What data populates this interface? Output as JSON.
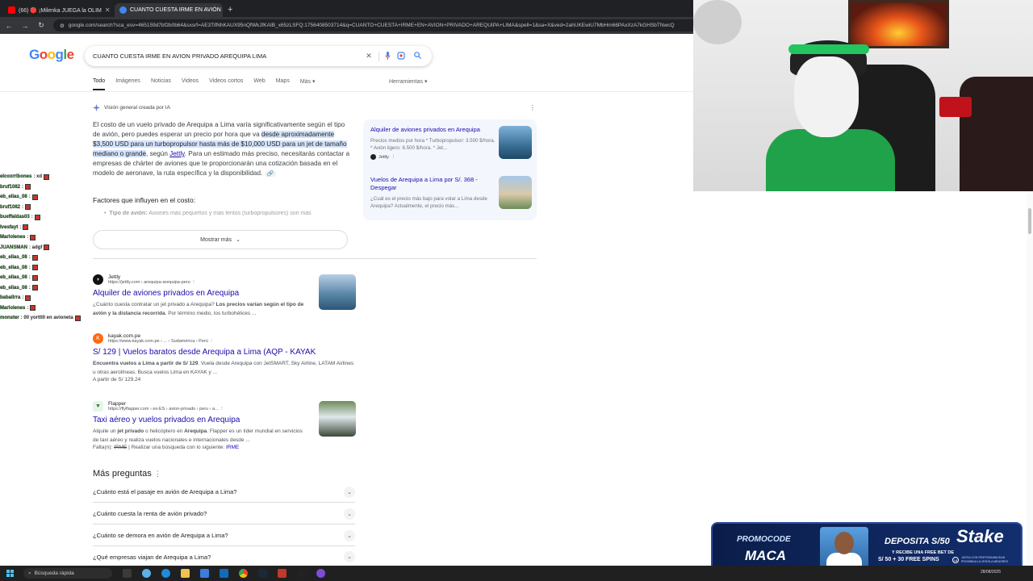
{
  "browser": {
    "tabs": [
      {
        "label": "(66) 🔴 ¡Milenka JUEGA la OLIM",
        "active": false
      },
      {
        "label": "CUANTO CUESTA IRME EN AVIÓN",
        "active": true
      }
    ],
    "url": "google.com/search?sca_esv=465159d7bf2b0b64&sxsrf=AE3TifNhKAUX95nQfWkJfKAIB_x65zLSFQ:1756408503714&q=CUANTO+CUESTA+IRME+EN+AVION+PRIVADO+AREQUIPA+LIMA&spell=1&sa=X&ved=2ahUKEwiU7MbHm66PAxXzA7kGHSbTNwcQ"
  },
  "google": {
    "logo": [
      "G",
      "o",
      "o",
      "g",
      "l",
      "e"
    ],
    "query": "CUANTO CUESTA IRME EN AVION PRIVADO AREQUIPA LIMA",
    "tabs": [
      "Todo",
      "Imágenes",
      "Noticias",
      "Videos",
      "Videos cortos",
      "Web",
      "Maps",
      "Más"
    ],
    "tools": "Herramientas"
  },
  "ai_overview": {
    "header": "Visión general creada por IA",
    "p1": "El costo de un vuelo privado de Arequipa a Lima varía significativamente según el tipo de avión, pero puedes esperar un precio por hora que va ",
    "highlight": "desde aproximadamente $3,500 USD para un turbopropulsor hasta más de $10,000 USD para un jet de tamaño mediano o grande",
    "p2": ", según ",
    "link": "Jettly",
    "p3": ". Para un estimado más preciso, necesitarás contactar a empresas de chárter de aviones que te proporcionarán una cotización basada en el modelo de aeronave, la ruta específica y la disponibilidad.",
    "factors_title": "Factores que influyen en el costo:",
    "factor1_label": "Tipo de avión:",
    "factor1_text": " Aviones más pequeños y más lentos (turbopropulsores) son más",
    "show_more": "Mostrar más",
    "cards": [
      {
        "title": "Alquiler de aviones privados en Arequipa",
        "desc": "Precios medios por hora * Turbopropulsor: 3.500 $/hora. * Avión ligero: 6.500 $/hora. * Jet...",
        "source": "Jettly"
      },
      {
        "title": "Vuelos de Arequipa a Lima por S/. 368 - Despegar",
        "desc": "¿Cuál es el precio más bajo para volar a Lima desde Arequipa? Actualmente, el precio más..."
      }
    ]
  },
  "results": [
    {
      "site": "Jettly",
      "url": "https://jettly.com › arequipa-arequipa-peru",
      "title": "Alquiler de aviones privados en Arequipa",
      "snippet_a": "¿Cuánto cuesta contratar un jet privado a Arequipa? ",
      "snippet_b": "Los precios varían según el tipo de avión y la distancia recorrida",
      "snippet_c": ". Por término medio, los turbohélices ..."
    },
    {
      "site": "kayak.com.pe",
      "url": "https://www.kayak.com.pe › ... › Sudamérica › Perú",
      "title": "S/ 129 | Vuelos baratos desde Arequipa a Lima (AQP - KAYAK",
      "snippet_a": "Encuentra vuelos a Lima a partir de S/ 129",
      "snippet_c": ". Vuela desde Arequipa con JetSMART, Sky Airline, LATAM Airlines u otras aerolíneas. Busca vuelos Lima en KAYAK y ...",
      "extra": "A partir de S/ 129.24"
    },
    {
      "site": "Flapper",
      "url": "https://flyflapper.com › es-ES › avion-privado › peru › a...",
      "title": "Taxi aéreo y vuelos privados en Arequipa",
      "snippet_a": "Alquile un ",
      "snippet_b": "jet privado",
      "snippet_c": " o helicóptero en ",
      "snippet_d": "Arequipa",
      "snippet_e": ". Flapper es un líder mundial en servicios de taxi aéreo y realiza vuelos nacionales e internacionales desde ...",
      "missing": "Falta(n): ",
      "missing_word": "IRME",
      "missing_sep": " | Realizar una búsqueda con lo siguiente: ",
      "missing_link": "IRME"
    }
  ],
  "paa": {
    "title": "Más preguntas",
    "items": [
      "¿Cuánto está el pasaje en avión de Arequipa a Lima?",
      "¿Cuánto cuesta la renta de avión privado?",
      "¿Cuánto se demora en avión de Arequipa a Lima?",
      "¿Qué empresas viajan de Arequipa a Lima?"
    ]
  },
  "chat": [
    {
      "user": "elcoxrribones",
      "msg": ": xd"
    },
    {
      "user": "bruf1082",
      "msg": ":"
    },
    {
      "user": "eb_elias_08",
      "msg": ":"
    },
    {
      "user": "bruf1082",
      "msg": ":"
    },
    {
      "user": "bueffaldas03",
      "msg": ":"
    },
    {
      "user": "Ivesfayt",
      "msg": ":"
    },
    {
      "user": "Marlolenes",
      "msg": ":"
    },
    {
      "user": "JUANSMAN",
      "msg": ": adgf"
    },
    {
      "user": "eb_elias_08",
      "msg": ":"
    },
    {
      "user": "eb_elias_08",
      "msg": ":"
    },
    {
      "user": "eb_elias_08",
      "msg": ":"
    },
    {
      "user": "eb_elias_08",
      "msg": ":"
    },
    {
      "user": "babalirra",
      "msg": ":"
    },
    {
      "user": "Marlolenes",
      "msg": ":"
    },
    {
      "user": "monster",
      "msg": ": 0ll yorttlll en avioneta"
    }
  ],
  "banner": {
    "promo_label": "PROMOCODE",
    "promo_code": "MACA",
    "deposit": "DEPOSITA S/50",
    "deposit_sub": "Y RECIBE UNA FREE BET DE",
    "deposit_offer": "S/ 50 + 30 FREE SPINS",
    "brand": "Stake",
    "age": "18",
    "fine_print": "JUEGA CON RESPONSABILIDAD. PROHIBIDA LA VENTA A MENORES"
  },
  "taskbar": {
    "search": "Búsqueda rápida",
    "date": "28/08/2025"
  },
  "colors": {
    "link": "#1a0dab",
    "highlight": "#d3e3fd",
    "chat_user": "#2d7a2d"
  }
}
